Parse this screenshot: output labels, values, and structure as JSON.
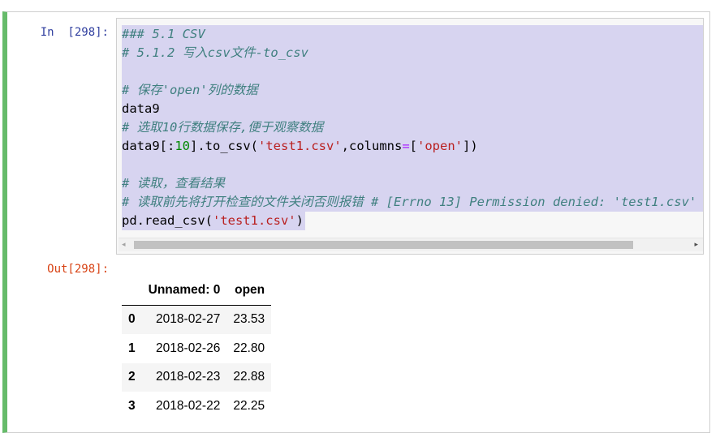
{
  "input_prompt": "In  [298]:",
  "output_prompt": "Out[298]:",
  "code": {
    "lines": [
      {
        "text": "### 5.1 CSV",
        "type": "comment"
      },
      {
        "text": "# 5.1.2 写入csv文件-to_csv",
        "type": "comment"
      },
      {
        "text": "",
        "type": "blank"
      },
      {
        "text": "# 保存'open'列的数据",
        "type": "comment"
      },
      {
        "text": "data9",
        "type": "code"
      },
      {
        "text": "# 选取10行数据保存,便于观察数据",
        "type": "comment"
      },
      {
        "text": "data9[:10].to_csv('test1.csv',columns=['open'])",
        "type": "code"
      },
      {
        "text": "",
        "type": "blank"
      },
      {
        "text": "# 读取，查看结果",
        "type": "comment"
      },
      {
        "text": "# 读取前先将打开检查的文件关闭否则报错 # [Errno 13] Permission denied: 'test1.csv'",
        "type": "comment"
      },
      {
        "text": "pd.read_csv('test1.csv')",
        "type": "code"
      }
    ],
    "tokens": {
      "line7": {
        "a": "data9[:",
        "num": "10",
        "b": "].to_csv(",
        "s1": "'test1.csv'",
        "c": ",columns",
        "eq": "=",
        "d": "[",
        "s2": "'open'",
        "e": "])"
      },
      "line11": {
        "a": "pd.read_csv(",
        "s1": "'test1.csv'",
        "b": ")"
      }
    }
  },
  "scrollbar": {
    "left_arrow": "◂",
    "right_arrow": "▸"
  },
  "table": {
    "columns": [
      "",
      "Unnamed: 0",
      "open"
    ],
    "rows": [
      {
        "index": "0",
        "date": "2018-02-27",
        "open": "23.53"
      },
      {
        "index": "1",
        "date": "2018-02-26",
        "open": "22.80"
      },
      {
        "index": "2",
        "date": "2018-02-23",
        "open": "22.88"
      },
      {
        "index": "3",
        "date": "2018-02-22",
        "open": "22.25"
      }
    ]
  },
  "colors": {
    "cell_border_active": "#66bb6a",
    "in_prompt": "#303f9f",
    "out_prompt": "#d84315",
    "selection": "#d7d4f0",
    "comment": "#408080"
  }
}
